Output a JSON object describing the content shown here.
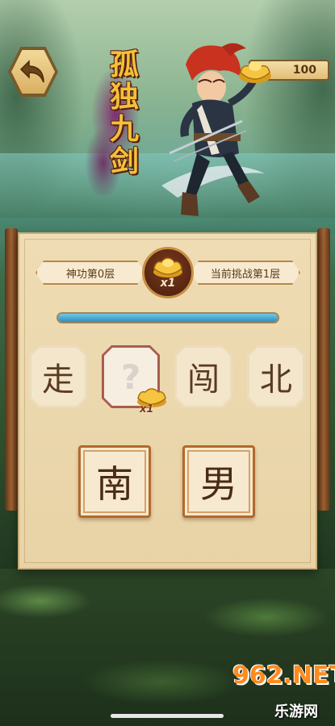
{
  "header": {
    "title_chars": [
      "孤",
      "独",
      "九",
      "剑"
    ],
    "coins": "100"
  },
  "level": {
    "left_label": "神功第0层",
    "right_label": "当前挑战第1层",
    "badge_multiplier": "x1",
    "progress_fraction": 1.0
  },
  "puzzle": {
    "tiles": [
      {
        "char": "走",
        "missing": false
      },
      {
        "char": "?",
        "missing": true
      },
      {
        "char": "闯",
        "missing": false
      },
      {
        "char": "北",
        "missing": false
      }
    ],
    "missing_reward": "x1"
  },
  "options": [
    "南",
    "男"
  ],
  "watermark": {
    "brand": "962.NET",
    "sub": "乐游网"
  },
  "colors": {
    "gold": "#f1c13a",
    "parchment": "#efdcb4",
    "progress": "#2d8fbf",
    "tile_border": "#b26a2c"
  }
}
